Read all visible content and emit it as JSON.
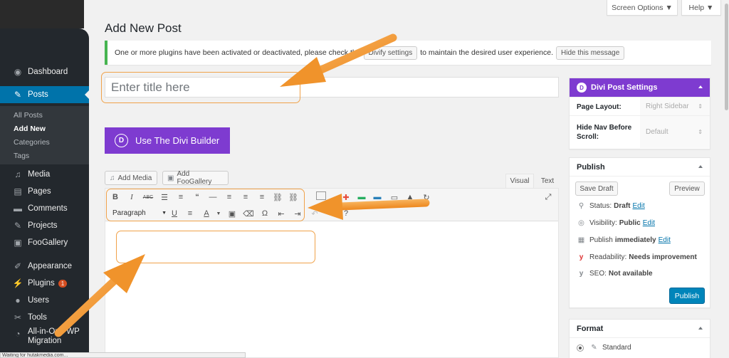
{
  "header": {
    "screen_options": "Screen Options ▼",
    "help": "Help ▼"
  },
  "sidebar": {
    "items": [
      {
        "label": "Dashboard",
        "icon": "dashboard-icon"
      },
      {
        "label": "Posts",
        "icon": "pushpin-icon"
      },
      {
        "label": "Media",
        "icon": "media-icon"
      },
      {
        "label": "Pages",
        "icon": "pages-icon"
      },
      {
        "label": "Comments",
        "icon": "comments-icon"
      },
      {
        "label": "Projects",
        "icon": "pushpin-icon"
      },
      {
        "label": "FooGallery",
        "icon": "gallery-icon"
      },
      {
        "label": "Appearance",
        "icon": "brush-icon"
      },
      {
        "label": "Plugins",
        "icon": "plugin-icon",
        "badge": "1"
      },
      {
        "label": "Users",
        "icon": "users-icon"
      },
      {
        "label": "Tools",
        "icon": "wrench-icon"
      },
      {
        "label": "All-in-One WP Migration",
        "label_line1": "All-in-One WP",
        "label_line2": "Migration",
        "icon": "migration-icon"
      }
    ],
    "submenu": [
      "All Posts",
      "Add New",
      "Categories",
      "Tags"
    ],
    "active_color": "#0073aa"
  },
  "page": {
    "title": "Add New Post"
  },
  "notice": {
    "text_before": "One or more plugins have been activated or deactivated, please check the",
    "button1": "Divify settings",
    "text_after": "to maintain the desired user experience.",
    "button2": "Hide this message"
  },
  "editor": {
    "title_placeholder": "Enter title here",
    "divi_button": "Use The Divi Builder",
    "divi_logo": "D",
    "divi_color": "#7e3bd0",
    "add_media": "Add Media",
    "add_foogallery": "Add FooGallery",
    "tab_visual": "Visual",
    "tab_text": "Text",
    "paragraph": "Paragraph",
    "toolbar_row1": [
      "B",
      "I",
      "ABC",
      "☰",
      "≡",
      "“",
      "—",
      "≡",
      "≡",
      "≡",
      "⛓",
      "⛓"
    ],
    "toolbar_row2": [
      "U",
      "≡",
      "A",
      "▣",
      "⌫",
      "Ω",
      "⇤",
      "⇥"
    ]
  },
  "divi_settings": {
    "title": "Divi Post Settings",
    "logo": "D",
    "page_layout_label": "Page Layout:",
    "page_layout_value": "Right Sidebar",
    "hide_nav_label_line1": "Hide Nav Before",
    "hide_nav_label_line2": "Scroll:",
    "hide_nav_value": "Default"
  },
  "publish": {
    "title": "Publish",
    "save_draft": "Save Draft",
    "preview": "Preview",
    "status_label": "Status:",
    "status_value": "Draft",
    "visibility_label": "Visibility:",
    "visibility_value": "Public",
    "publish_label": "Publish",
    "publish_value": "immediately",
    "readability_label": "Readability:",
    "readability_value": "Needs improvement",
    "seo_label": "SEO:",
    "seo_value": "Not available",
    "edit": "Edit",
    "publish_button": "Publish",
    "button_color": "#0085ba"
  },
  "format": {
    "title": "Format",
    "option": "Standard"
  },
  "status_bar": {
    "text": "Waiting for hutakmedia.com..."
  },
  "annotation_color": "#f0932b"
}
